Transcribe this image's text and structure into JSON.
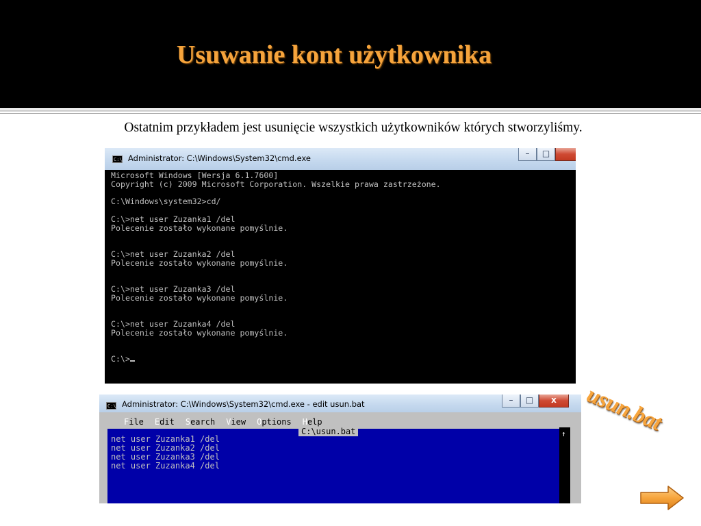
{
  "slide": {
    "title": "Usuwanie kont użytkownika",
    "text": "Ostatnim przykładem jest usunięcie wszystkich użytkowników których stworzyliśmy.",
    "side_label": "usun.bat",
    "accent_color": "#f6a43c"
  },
  "cmd_window": {
    "icon": "cmd-icon",
    "icon_text": "C:\\",
    "title": "Administrator: C:\\Windows\\System32\\cmd.exe",
    "minimize": "–",
    "maximize": "□",
    "lines": [
      "Microsoft Windows [Wersja 6.1.7600]",
      "Copyright (c) 2009 Microsoft Corporation. Wszelkie prawa zastrzeżone.",
      "",
      "C:\\Windows\\system32>cd/",
      "",
      "C:\\>net user Zuzanka1 /del",
      "Polecenie zostało wykonane pomyślnie.",
      "",
      "",
      "C:\\>net user Zuzanka2 /del",
      "Polecenie zostało wykonane pomyślnie.",
      "",
      "",
      "C:\\>net user Zuzanka3 /del",
      "Polecenie zostało wykonane pomyślnie.",
      "",
      "",
      "C:\\>net user Zuzanka4 /del",
      "Polecenie zostało wykonane pomyślnie.",
      "",
      ""
    ],
    "prompt": "C:\\>"
  },
  "edit_window": {
    "icon": "cmd-icon",
    "icon_text": "C:\\",
    "title": "Administrator: C:\\Windows\\System32\\cmd.exe - edit  usun.bat",
    "minimize": "–",
    "maximize": "□",
    "close": "x",
    "menu": [
      {
        "hot": "F",
        "rest": "ile"
      },
      {
        "hot": "E",
        "rest": "dit"
      },
      {
        "hot": "S",
        "rest": "earch"
      },
      {
        "hot": "V",
        "rest": "iew"
      },
      {
        "hot": "O",
        "rest": "ptions"
      },
      {
        "hot": "H",
        "rest": "elp"
      }
    ],
    "filename": "C:\\usun.bat",
    "lines": [
      "net user Zuzanka1 /del",
      "net user Zuzanka2 /del",
      "net user Zuzanka3 /del",
      "net user Zuzanka4 /del"
    ],
    "scroll_arrow": "↑",
    "colors": {
      "background": "#0000a8",
      "text": "#c0c0c0",
      "menu": "#c0c0c0"
    }
  },
  "next_button": {
    "icon": "arrow-right-icon",
    "color": "#f7a53d"
  }
}
